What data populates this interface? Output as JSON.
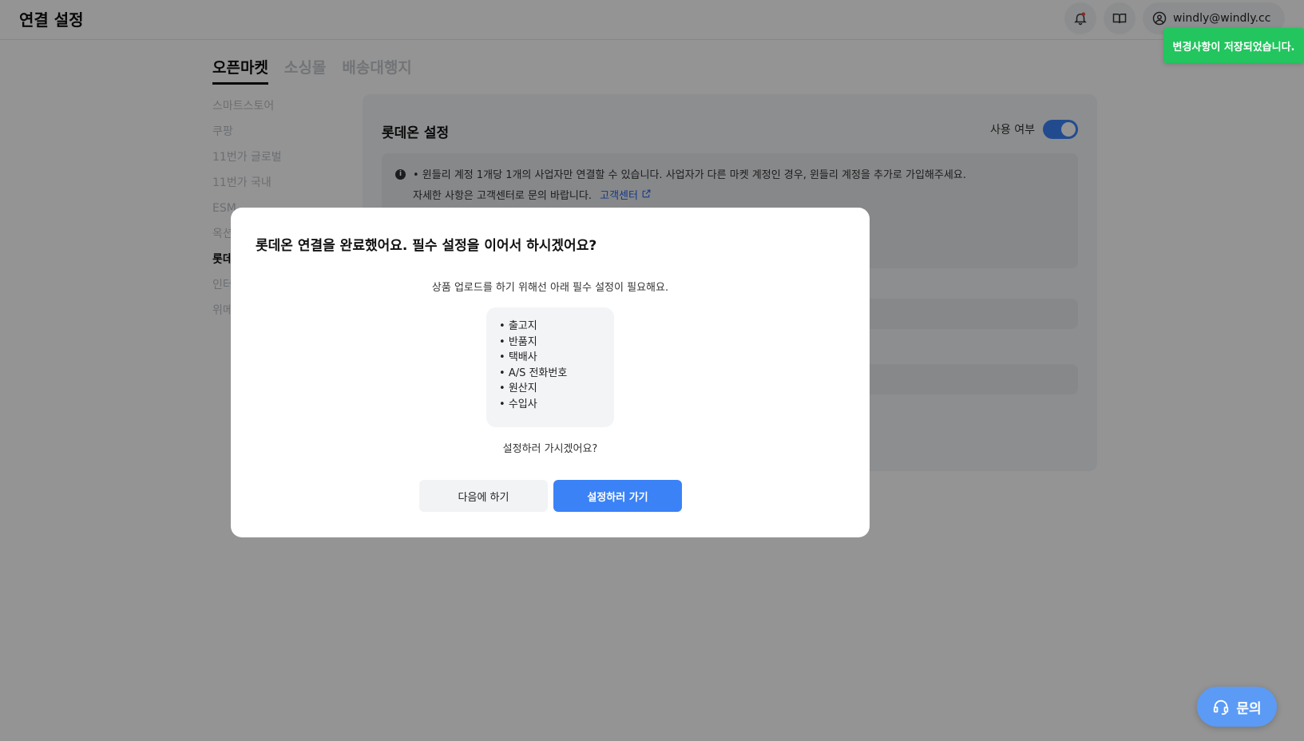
{
  "header": {
    "title": "연결 설정",
    "user_email": "windly@windly.cc",
    "icons": [
      "bell-icon",
      "book-icon",
      "user-circle-icon"
    ]
  },
  "toast": {
    "message": "변경사항이 저장되었습니다."
  },
  "tabs": [
    {
      "label": "오픈마켓",
      "active": true
    },
    {
      "label": "소싱몰",
      "active": false
    },
    {
      "label": "배송대행지",
      "active": false
    }
  ],
  "side_menu": [
    {
      "label": "스마트스토어",
      "active": false
    },
    {
      "label": "쿠팡",
      "active": false
    },
    {
      "label": "11번가 글로벌",
      "active": false
    },
    {
      "label": "11번가 국내",
      "active": false
    },
    {
      "label": "ESM",
      "active": false
    },
    {
      "label": "옥션",
      "active": false
    },
    {
      "label": "롯데",
      "active": true
    },
    {
      "label": "인터",
      "active": false
    },
    {
      "label": "위메",
      "active": false
    }
  ],
  "panel": {
    "title": "롯데온 설정",
    "use_label": "사용 여부",
    "use_enabled": true,
    "notice_line1": "• 윈들리 계정 1개당 1개의 사업자만 연결할 수 있습니다. 사업자가 다른 마켓 계정인 경우, 윈들리 계정을 추가로 가입해주세요.",
    "notice_line2": "자세한 사항은 고객센터로 문의 바랍니다.",
    "notice_link": "고객센터"
  },
  "modal": {
    "title": "롯데온 연결을 완료했어요. 필수 설정을 이어서 하시겠어요?",
    "description": "상품 업로드를 하기 위해선 아래 필수 설정이 필요해요.",
    "required_items": [
      "출고지",
      "반품지",
      "택배사",
      "A/S 전화번호",
      "원산지",
      "수입사"
    ],
    "question": "설정하러 가시겠어요?",
    "later_label": "다음에 하기",
    "go_label": "설정하러 가기"
  },
  "chat": {
    "label": "문의"
  },
  "colors": {
    "accent": "#3b82f6",
    "toast_bg": "#22c55e",
    "chat_bg": "#5b9bf6"
  }
}
